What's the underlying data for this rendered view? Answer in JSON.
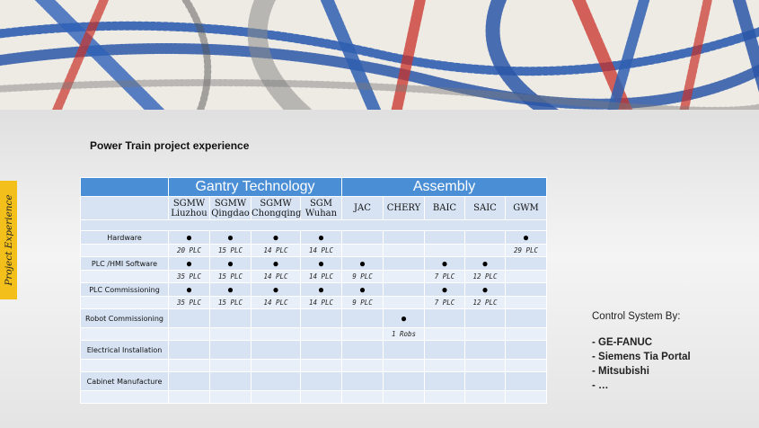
{
  "side_tab": "Project Experience",
  "title": "Power Train project experience",
  "groups": {
    "gantry": "Gantry Technology",
    "assembly": "Assembly"
  },
  "companies": [
    {
      "line1": "SGMW",
      "line2": "Liuzhou"
    },
    {
      "line1": "SGMW",
      "line2": "Qingdao"
    },
    {
      "line1": "SGMW",
      "line2": "Chongqing"
    },
    {
      "line1": "SGM",
      "line2": "Wuhan"
    },
    {
      "line1": "JAC",
      "line2": ""
    },
    {
      "line1": "CHERY",
      "line2": ""
    },
    {
      "line1": "BAIC",
      "line2": ""
    },
    {
      "line1": "SAIC",
      "line2": ""
    },
    {
      "line1": "GWM",
      "line2": ""
    }
  ],
  "rows": [
    {
      "label": "Hardware",
      "dots": [
        1,
        1,
        1,
        1,
        0,
        0,
        0,
        0,
        1
      ],
      "values": [
        "20 PLC",
        "15 PLC",
        "14 PLC",
        "14 PLC",
        "",
        "",
        "",
        "",
        "29 PLC"
      ]
    },
    {
      "label": "PLC /HMI Software",
      "dots": [
        1,
        1,
        1,
        1,
        1,
        0,
        1,
        1,
        0
      ],
      "values": [
        "35 PLC",
        "15 PLC",
        "14 PLC",
        "14 PLC",
        "9 PLC",
        "",
        "7 PLC",
        "12 PLC",
        ""
      ]
    },
    {
      "label": "PLC Commissioning",
      "dots": [
        1,
        1,
        1,
        1,
        1,
        0,
        1,
        1,
        0
      ],
      "values": [
        "35 PLC",
        "15 PLC",
        "14 PLC",
        "14 PLC",
        "9 PLC",
        "",
        "7 PLC",
        "12 PLC",
        ""
      ]
    },
    {
      "label": "Robot Commissioning",
      "dots": [
        0,
        0,
        0,
        0,
        0,
        1,
        0,
        0,
        0
      ],
      "values": [
        "",
        "",
        "",
        "",
        "",
        "1 Robs",
        "",
        "",
        ""
      ]
    },
    {
      "label": "Electrical Installation",
      "dots": [
        0,
        0,
        0,
        0,
        0,
        0,
        0,
        0,
        0
      ],
      "values": [
        "",
        "",
        "",
        "",
        "",
        "",
        "",
        "",
        ""
      ]
    },
    {
      "label": "Cabinet Manufacture",
      "dots": [
        0,
        0,
        0,
        0,
        0,
        0,
        0,
        0,
        0
      ],
      "values": [
        "",
        "",
        "",
        "",
        "",
        "",
        "",
        "",
        ""
      ]
    }
  ],
  "control": {
    "heading": "Control System By:",
    "items": [
      "- GE-FANUC",
      "- Siemens Tia Portal",
      "- Mitsubishi",
      "- …"
    ]
  },
  "colors": {
    "header_blue": "#4a8ed6",
    "cell_light": "#d7e3f3",
    "side_tab": "#f3bf1a"
  }
}
